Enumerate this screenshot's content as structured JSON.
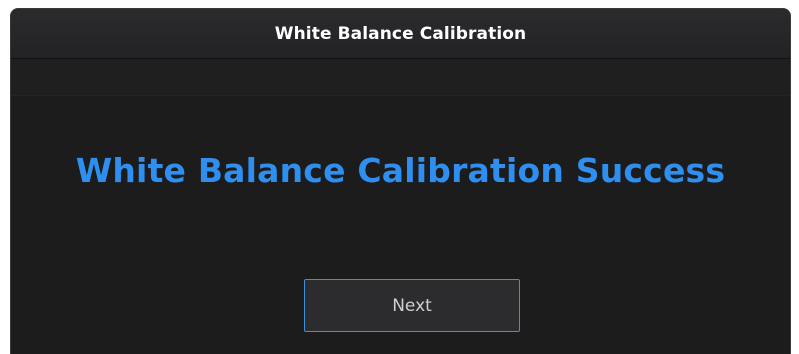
{
  "dialog": {
    "title": "White Balance Calibration",
    "message": "White Balance Calibration Success",
    "next_label": "Next"
  },
  "colors": {
    "background": "#1c1c1d",
    "accent": "#2f8ff0",
    "title_text": "#ffffff",
    "button_border": "#3d8fe0"
  }
}
